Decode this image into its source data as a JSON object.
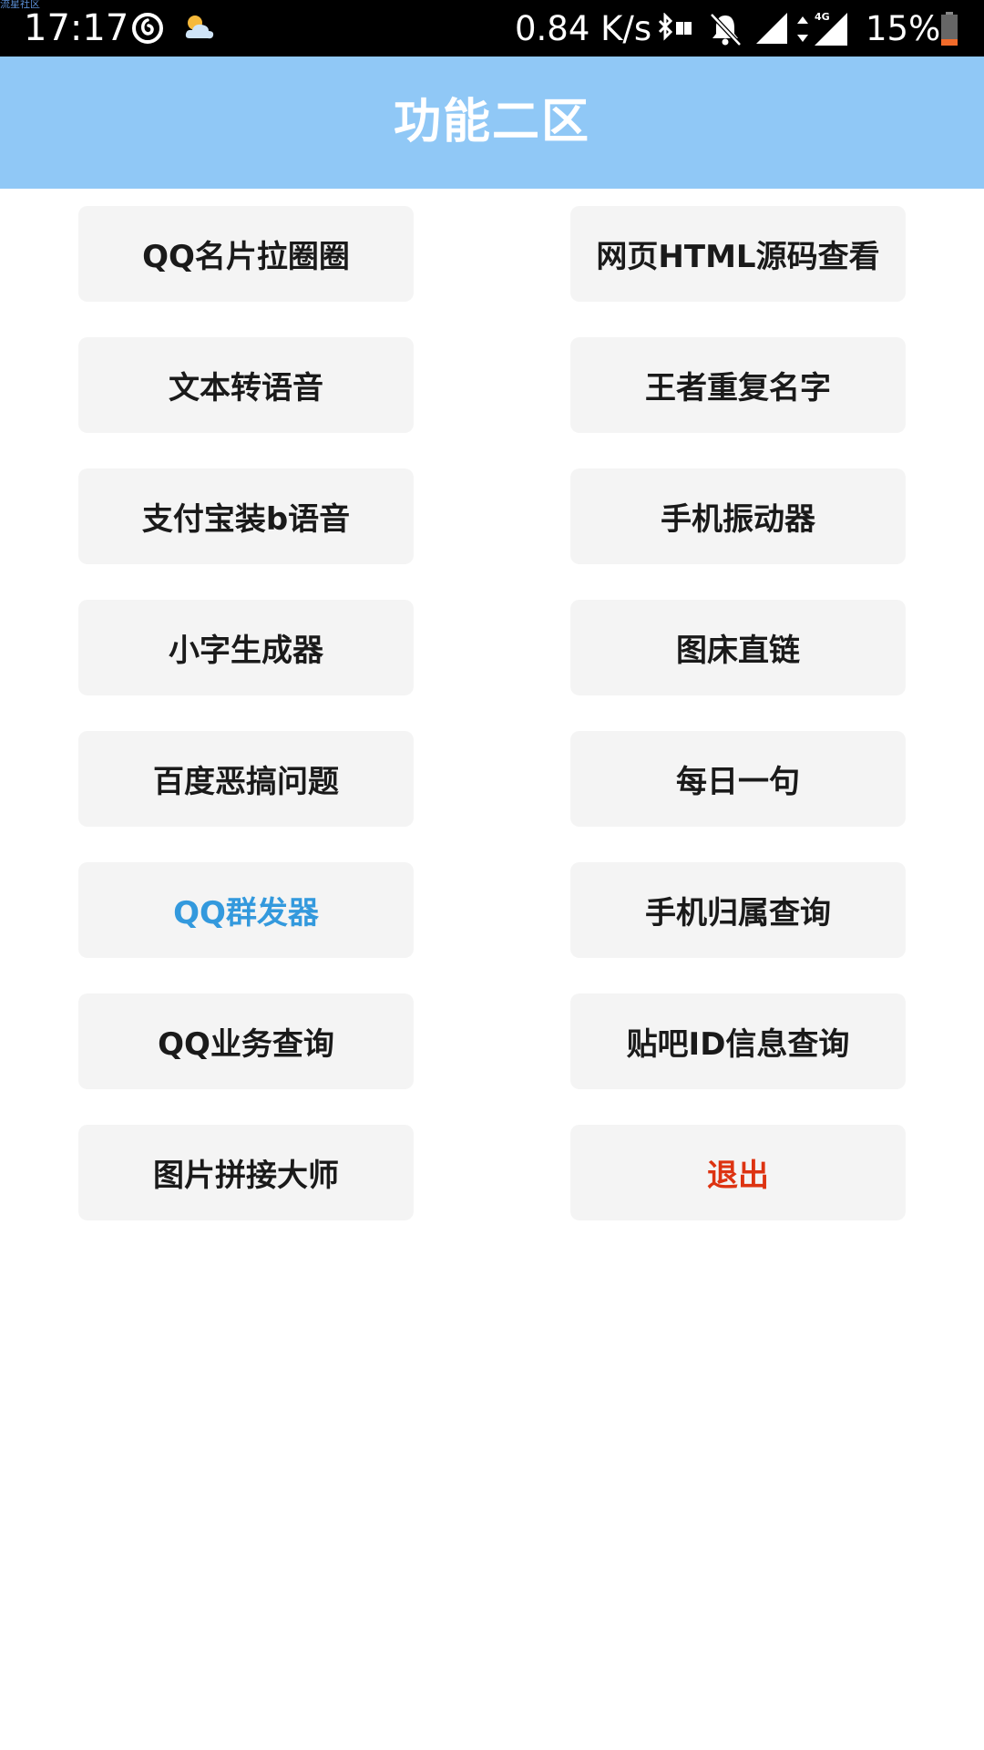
{
  "status_bar": {
    "watermark": "流星社区",
    "time": "17:17",
    "net_speed": "0.84 K/s",
    "network_type": "4G",
    "battery": "15%",
    "icons": [
      "netease-music-icon",
      "weather-cloud-sun-icon",
      "bluetooth-icon",
      "mute-bell-icon",
      "signal-icon",
      "data-arrows-icon",
      "signal-4g-icon",
      "battery-icon"
    ]
  },
  "header": {
    "title": "功能二区"
  },
  "buttons": [
    {
      "label": "QQ名片拉圈圈",
      "color": "#1a1a1a"
    },
    {
      "label": "网页HTML源码查看",
      "color": "#1a1a1a"
    },
    {
      "label": "文本转语音",
      "color": "#1a1a1a"
    },
    {
      "label": "王者重复名字",
      "color": "#1a1a1a"
    },
    {
      "label": "支付宝装b语音",
      "color": "#1a1a1a"
    },
    {
      "label": "手机振动器",
      "color": "#1a1a1a"
    },
    {
      "label": "小字生成器",
      "color": "#1a1a1a"
    },
    {
      "label": "图床直链",
      "color": "#1a1a1a"
    },
    {
      "label": "百度恶搞问题",
      "color": "#1a1a1a"
    },
    {
      "label": "每日一句",
      "color": "#1a1a1a"
    },
    {
      "label": "QQ群发器",
      "color": "#3399dd"
    },
    {
      "label": "手机归属查询",
      "color": "#1a1a1a"
    },
    {
      "label": "QQ业务查询",
      "color": "#1a1a1a"
    },
    {
      "label": "贴吧ID信息查询",
      "color": "#1a1a1a"
    },
    {
      "label": "图片拼接大师",
      "color": "#1a1a1a"
    },
    {
      "label": "退出",
      "color": "#dd3311"
    }
  ],
  "colors": {
    "header_bg": "#90c8f6",
    "button_bg": "#f4f4f4",
    "status_bar_bg": "#000000"
  }
}
